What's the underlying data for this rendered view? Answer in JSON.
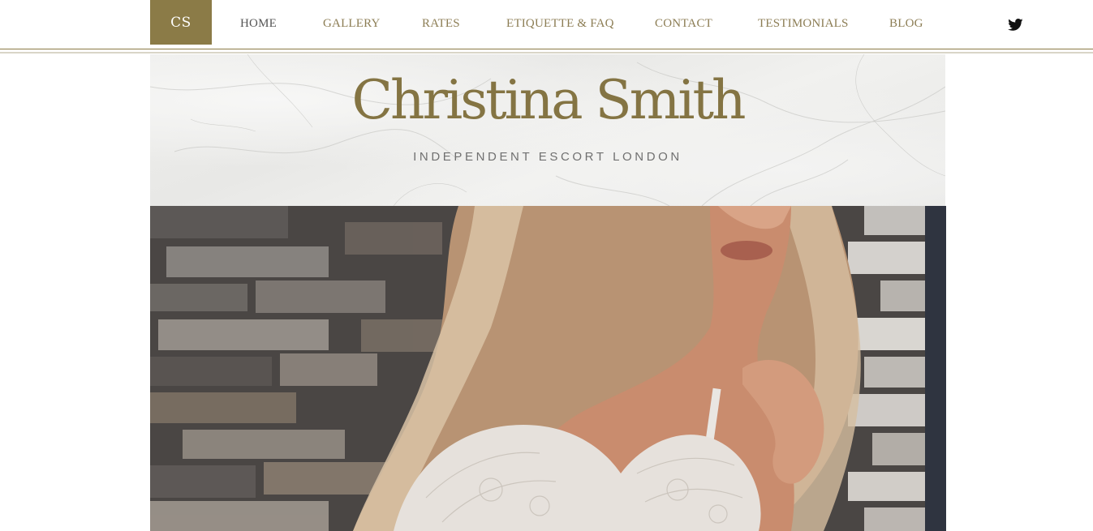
{
  "header": {
    "logo_text": "CS",
    "nav": [
      {
        "label": "HOME",
        "active": true
      },
      {
        "label": "GALLERY",
        "active": false
      },
      {
        "label": "RATES",
        "active": false
      },
      {
        "label": "ETIQUETTE & FAQ",
        "active": false
      },
      {
        "label": "CONTACT",
        "active": false
      },
      {
        "label": "TESTIMONIALS",
        "active": false
      },
      {
        "label": "BLOG",
        "active": false
      }
    ],
    "social_icon": "twitter-icon"
  },
  "banner": {
    "title": "Christina Smith",
    "tagline": "INDEPENDENT ESCORT LONDON"
  },
  "colors": {
    "gold": "#8b7b47",
    "nav_text": "#8c7d54",
    "nav_active": "#555555",
    "title_gold": "#847443"
  }
}
